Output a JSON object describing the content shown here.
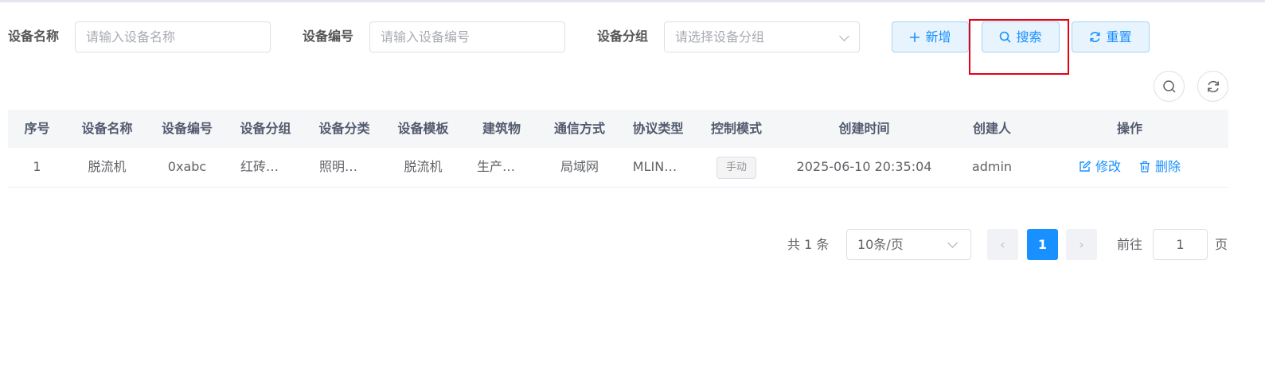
{
  "filters": {
    "name_label": "设备名称",
    "name_placeholder": "请输入设备名称",
    "code_label": "设备编号",
    "code_placeholder": "请输入设备编号",
    "group_label": "设备分组",
    "group_placeholder": "请选择设备分组"
  },
  "buttons": {
    "add": "新增",
    "search": "搜索",
    "reset": "重置"
  },
  "table": {
    "headers": [
      "序号",
      "设备名称",
      "设备编号",
      "设备分组",
      "设备分类",
      "设备模板",
      "建筑物",
      "通信方式",
      "协议类型",
      "控制模式",
      "创建时间",
      "创建人",
      "操作"
    ],
    "rows": [
      {
        "index": "1",
        "name": "脱流机",
        "code": "0xabc",
        "group": "红砖…",
        "category": "照明…",
        "template": "脱流机",
        "building": "生产…",
        "comm": "局域网",
        "protocol": "MLIN…",
        "mode": "手动",
        "created_at": "2025-06-10 20:35:04",
        "creator": "admin",
        "edit": "修改",
        "delete": "删除"
      }
    ]
  },
  "pagination": {
    "total": "共 1 条",
    "page_size": "10条/页",
    "current_page": "1",
    "goto_label": "前往",
    "goto_value": "1",
    "page_suffix": "页"
  },
  "colors": {
    "primary": "#1890ff",
    "highlight": "#e60012"
  }
}
